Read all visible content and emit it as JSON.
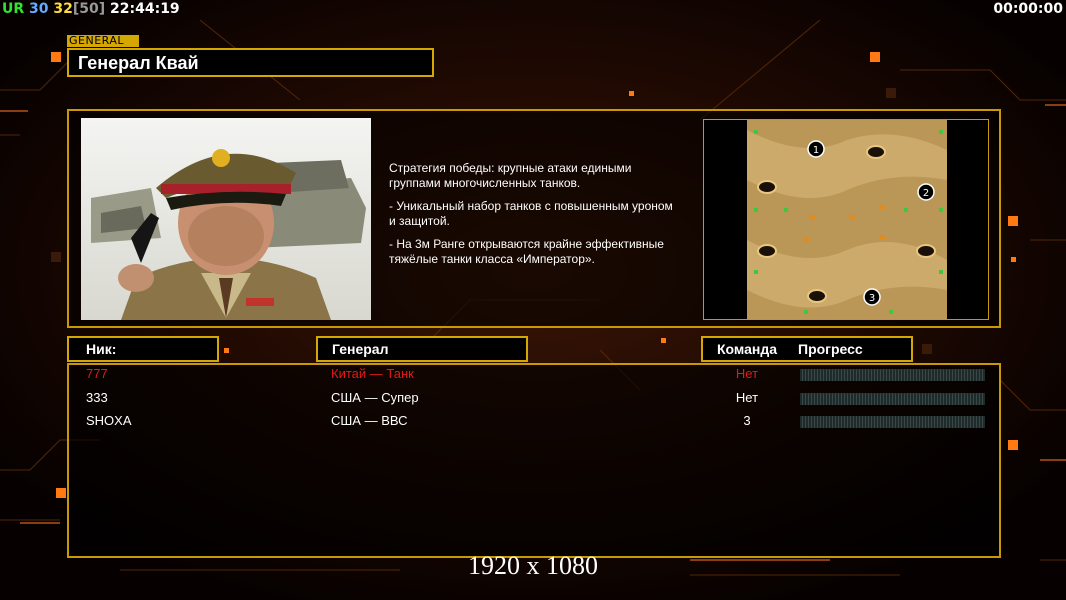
{
  "hud": {
    "ur_label": "UR",
    "fps": "30",
    "fps2": "32",
    "fps_limit": "[50]",
    "clock": "22:44:19",
    "game_timer": "00:00:00"
  },
  "general": {
    "tag": "GENERAL",
    "name": "Генерал Квай",
    "description": [
      "Стратегия победы: крупные атаки едиными\n группами многочисленных танков.",
      "- Уникальный набор танков с повышенным уроном\n и защитой.",
      "- На 3м Ранге открываются крайне эффективные\n тяжёлые танки класса «Император»."
    ]
  },
  "map": {
    "start_labels": [
      "1",
      "2",
      "3"
    ]
  },
  "table": {
    "headers": {
      "nick": "Ник:",
      "general": "Генерал",
      "team": "Команда",
      "progress": "Прогресс"
    },
    "rows": [
      {
        "nick": "777",
        "general": "Китай — Танк",
        "team": "Нет",
        "progress": 0,
        "color": "#e01a1a"
      },
      {
        "nick": "333",
        "general": "США — Супер",
        "team": "Нет",
        "progress": 0,
        "color": "#ffffff"
      },
      {
        "nick": "SHOXA",
        "general": "США — ВВС",
        "team": "3",
        "progress": 0,
        "color": "#ffffff"
      }
    ]
  },
  "resolution_label": "1920 x 1080",
  "colors": {
    "accent": "#d4a800",
    "orange": "#ff8a1a",
    "ur": "#2ee62e",
    "fps": "#66aaff",
    "fps2": "#ffdd33",
    "fps_limit": "#999999"
  }
}
